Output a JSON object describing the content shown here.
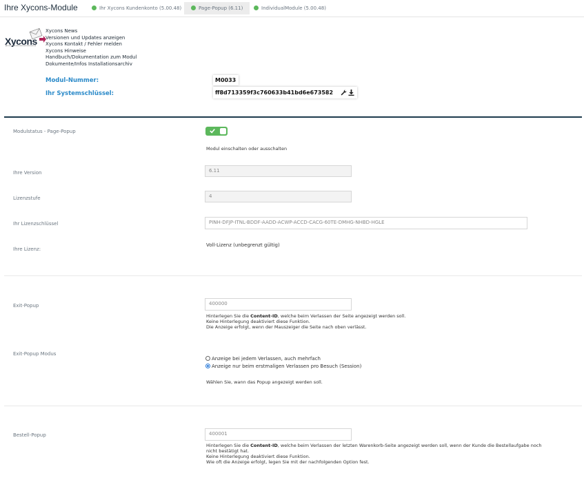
{
  "header": {
    "title": "Ihre Xycons-Module",
    "tabs": [
      {
        "label": "Ihr Xycons Kundenkonto (5.00.48)",
        "active": false
      },
      {
        "label": "Page-Popup (6.11)",
        "active": true
      },
      {
        "label": "IndividualModule (5.00.48)",
        "active": false
      }
    ]
  },
  "logo": {
    "text": "Xycons"
  },
  "links": [
    "Xycons News",
    "Versionen und Updates anzeigen",
    "Xycons Kontakt / Fehler melden",
    "Xycons Hinweise",
    "Handbuch/Dokumentation zum Modul",
    "Dokumente/Infos Installationsarchiv"
  ],
  "module": {
    "number_label": "Modul-Nummer:",
    "number_value": "M0033",
    "key_label": "Ihr Systemschlüssel:",
    "key_value": "ff8d713359f3c760633b41bd6e673582"
  },
  "settings": {
    "status": {
      "label": "Modulstatus - Page-Popup",
      "enabled": true,
      "help": "Modul einschalten oder ausschalten"
    },
    "version": {
      "label": "Ihre Version",
      "value": "6.11"
    },
    "level": {
      "label": "Lizenzstufe",
      "value": "4"
    },
    "license_key": {
      "label": "Ihr Lizenzschlüssel",
      "value": "PINH-DFJP-ITNL-BDDF-AADD-ACWP-ACCD-CACG-60TE-DMHG-NHBD-HGLE"
    },
    "license": {
      "label": "Ihre Lizenz:",
      "value": "Voll-Lizenz (unbegrenzt gültig)"
    }
  },
  "exit_popup": {
    "label": "Exit-Popup",
    "value": "400000",
    "help_pre": "Hinterlegen Sie die ",
    "help_bold": "Content-ID",
    "help_post": ", welche beim Verlassen der Seite angezeigt werden soll.",
    "help2": "Keine Hinterlegung deaktiviert diese Funktion.",
    "help3": "Die Anzeige erfolgt, wenn der Mauszeiger die Seite nach oben verlässt."
  },
  "exit_mode": {
    "label": "Exit-Popup Modus",
    "options": [
      {
        "label": "Anzeige bei jedem Verlassen, auch mehrfach",
        "selected": false
      },
      {
        "label": "Anzeige nur beim erstmaligen Verlassen pro Besuch (Session)",
        "selected": true
      }
    ],
    "help": "Wählen Sie, wann das Popup angezeigt werden soll."
  },
  "order_popup": {
    "label": "Bestell-Popup",
    "value": "400001",
    "help_pre": "Hinterlegen Sie die ",
    "help_bold": "Content-ID",
    "help_post": ", welche beim Verlassen der letzten Warenkorb-Seite angezeigt werden soll, wenn der Kunde die Bestellaufgabe noch",
    "help_post2": "nicht bestätigt hat.",
    "help2": "Keine Hinterlegung deaktiviert diese Funktion.",
    "help3": "Wie oft die Anzeige erfolgt, legen Sie mit der nachfolgenden Option fest."
  },
  "colors": {
    "accent": "#2b8ac9",
    "toggle_on": "#5cb85c",
    "divider": "#1c3a4c"
  },
  "icons": [
    "wrench-icon",
    "download-icon",
    "check-icon",
    "envelope-icon"
  ]
}
